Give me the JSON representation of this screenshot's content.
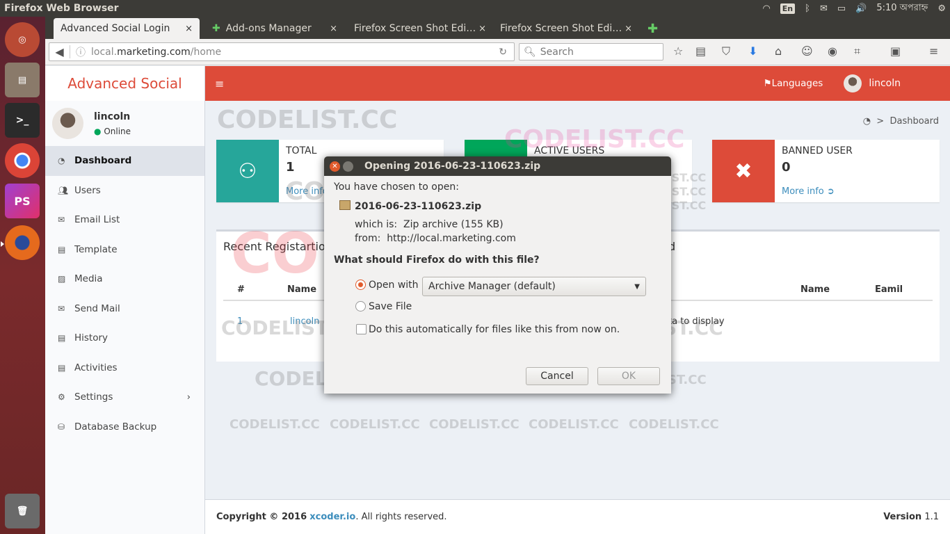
{
  "os": {
    "window_title": "Firefox Web Browser",
    "keyboard": "En",
    "clock": "5:10 অপরাহ্ন"
  },
  "tabs": [
    {
      "label": "Advanced Social Login",
      "close": "×"
    },
    {
      "label": "Add-ons Manager",
      "close": "×"
    },
    {
      "label": "Firefox Screen Shot Edi…",
      "close": "×"
    },
    {
      "label": "Firefox Screen Shot Edi…",
      "close": "×"
    }
  ],
  "new_tab": "✚",
  "url": {
    "prefix": "local.",
    "domain": "marketing.com",
    "path": "/home"
  },
  "search_placeholder": "Search",
  "app": {
    "logo": "Advanced Social",
    "user_name": "lincoln",
    "user_status": "Online",
    "menu": [
      {
        "icon": "dashboard-icon",
        "label": "Dashboard"
      },
      {
        "icon": "users-icon",
        "label": "Users"
      },
      {
        "icon": "envelope-icon",
        "label": "Email List"
      },
      {
        "icon": "template-icon",
        "label": "Template"
      },
      {
        "icon": "image-icon",
        "label": "Media"
      },
      {
        "icon": "send-icon",
        "label": "Send Mail"
      },
      {
        "icon": "history-icon",
        "label": "History"
      },
      {
        "icon": "activities-icon",
        "label": "Activities"
      },
      {
        "icon": "settings-icon",
        "label": "Settings"
      },
      {
        "icon": "database-icon",
        "label": "Database Backup"
      }
    ],
    "header_languages": "Languages",
    "header_user": "lincoln",
    "breadcrumb": "Dashboard",
    "boxes": [
      {
        "title": "TOTAL",
        "value": "1",
        "more": "More info",
        "color": "#26a69a"
      },
      {
        "title": "ACTIVE USERS",
        "value": "",
        "more": "",
        "color": "#00a65a"
      },
      {
        "title": "BANNED USER",
        "value": "0",
        "more": "More info",
        "color": "#dd4b39"
      }
    ],
    "panel_title": "Recent Registartion",
    "panel_title_right_fragment": "d",
    "table_headers": [
      "#",
      "Name"
    ],
    "table_headers_right": [
      "Name",
      "Eamil"
    ],
    "table_row": [
      "1",
      "lincoln"
    ],
    "no_data": "ta to display",
    "footer_copyright": "Copyright © 2016",
    "footer_link": "xcoder.io",
    "footer_rights": ". All rights reserved.",
    "footer_version_label": "Version",
    "footer_version": "1.1"
  },
  "dialog": {
    "title": "Opening 2016-06-23-110623.zip",
    "intro": "You have chosen to open:",
    "filename": "2016-06-23-110623.zip",
    "which_is_label": "which is:",
    "which_is": "Zip archive (155 KB)",
    "from_label": "from:",
    "from": "http://local.marketing.com",
    "question": "What should Firefox do with this file?",
    "open_with_label": "Open with",
    "open_with_value": "Archive Manager (default)",
    "save_label": "Save File",
    "auto_label": "Do this automatically for files like this from now on.",
    "cancel": "Cancel",
    "ok": "OK"
  },
  "watermark": "CODELIST.CC"
}
